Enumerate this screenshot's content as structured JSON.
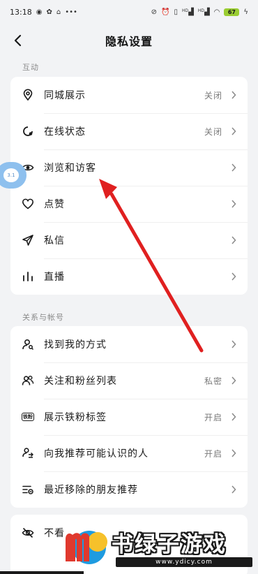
{
  "status_bar": {
    "time": "13:18",
    "left_icons": [
      "weibo-icon",
      "settings-app-icon",
      "home-icon",
      "more-dots-icon"
    ],
    "right_icons": [
      "mute-icon",
      "alarm-icon",
      "vibrate-icon",
      "hd-signal-icon",
      "hd-signal-icon",
      "wifi-icon",
      "battery-icon",
      "charging-icon"
    ],
    "hd1": "HD",
    "hd2": "HD",
    "battery": "67"
  },
  "nav": {
    "title": "隐私设置"
  },
  "sections": {
    "interaction": {
      "label": "互动",
      "items": [
        {
          "label": "同城展示",
          "value": "关闭",
          "icon": "location-pin-icon"
        },
        {
          "label": "在线状态",
          "value": "关闭",
          "icon": "online-status-icon"
        },
        {
          "label": "浏览和访客",
          "value": "",
          "icon": "eye-icon"
        },
        {
          "label": "点赞",
          "value": "",
          "icon": "heart-icon"
        },
        {
          "label": "私信",
          "value": "",
          "icon": "send-icon"
        },
        {
          "label": "直播",
          "value": "",
          "icon": "bar-chart-icon"
        }
      ]
    },
    "relations": {
      "label": "关系与帐号",
      "items": [
        {
          "label": "找到我的方式",
          "value": "",
          "icon": "user-search-icon"
        },
        {
          "label": "关注和粉丝列表",
          "value": "私密",
          "icon": "users-icon"
        },
        {
          "label": "展示铁粉标签",
          "value": "开启",
          "icon": "fan-badge-icon",
          "badge": "铁粉"
        },
        {
          "label": "向我推荐可能认识的人",
          "value": "开启",
          "icon": "recommend-people-icon"
        },
        {
          "label": "最近移除的朋友推荐",
          "value": "",
          "icon": "removed-list-icon"
        }
      ]
    },
    "third": {
      "items": [
        {
          "label": "不看",
          "value": "",
          "icon": "eye-off-icon"
        }
      ]
    }
  },
  "float_bubble": {
    "text": "3.1"
  },
  "watermark": {
    "text": "书绿子游戏",
    "url": "www.ydicy.com"
  },
  "colors": {
    "background": "#f2f3f5",
    "card": "#ffffff",
    "arrow": "#e02020",
    "muted_text": "#7a7a7a"
  }
}
